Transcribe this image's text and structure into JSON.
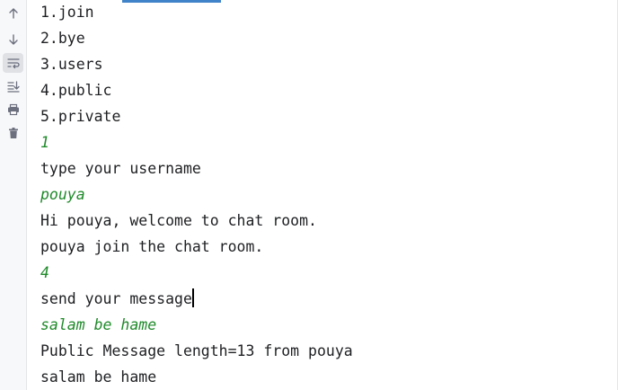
{
  "colors": {
    "output_text": "#1e1f22",
    "input_text": "#1f8a2a",
    "gutter_bg": "#f7f8fa",
    "accent": "#4083c9"
  },
  "toolbar": [
    {
      "icon": "arrow-up-icon",
      "action": "up-the-stack"
    },
    {
      "icon": "arrow-down-icon",
      "action": "down-the-stack"
    },
    {
      "icon": "soft-wrap-icon",
      "action": "soft-wrap",
      "active": true
    },
    {
      "icon": "scroll-to-end-icon",
      "action": "scroll-to-end"
    },
    {
      "icon": "print-icon",
      "action": "print"
    },
    {
      "icon": "trash-icon",
      "action": "clear-all"
    }
  ],
  "console": {
    "lines": [
      {
        "text": "1.join",
        "kind": "output"
      },
      {
        "text": "2.bye",
        "kind": "output"
      },
      {
        "text": "3.users",
        "kind": "output"
      },
      {
        "text": "4.public",
        "kind": "output"
      },
      {
        "text": "5.private",
        "kind": "output"
      },
      {
        "text": "1",
        "kind": "input"
      },
      {
        "text": "type your username",
        "kind": "output"
      },
      {
        "text": "pouya",
        "kind": "input"
      },
      {
        "text": "Hi pouya, welcome to chat room.",
        "kind": "output"
      },
      {
        "text": "pouya join the chat room.",
        "kind": "output"
      },
      {
        "text": "4",
        "kind": "input"
      },
      {
        "text": "send your message",
        "kind": "output",
        "caret": true
      },
      {
        "text": "salam be hame",
        "kind": "input"
      },
      {
        "text": "Public Message length=13 from pouya",
        "kind": "output"
      },
      {
        "text": "salam be hame",
        "kind": "output"
      }
    ]
  }
}
